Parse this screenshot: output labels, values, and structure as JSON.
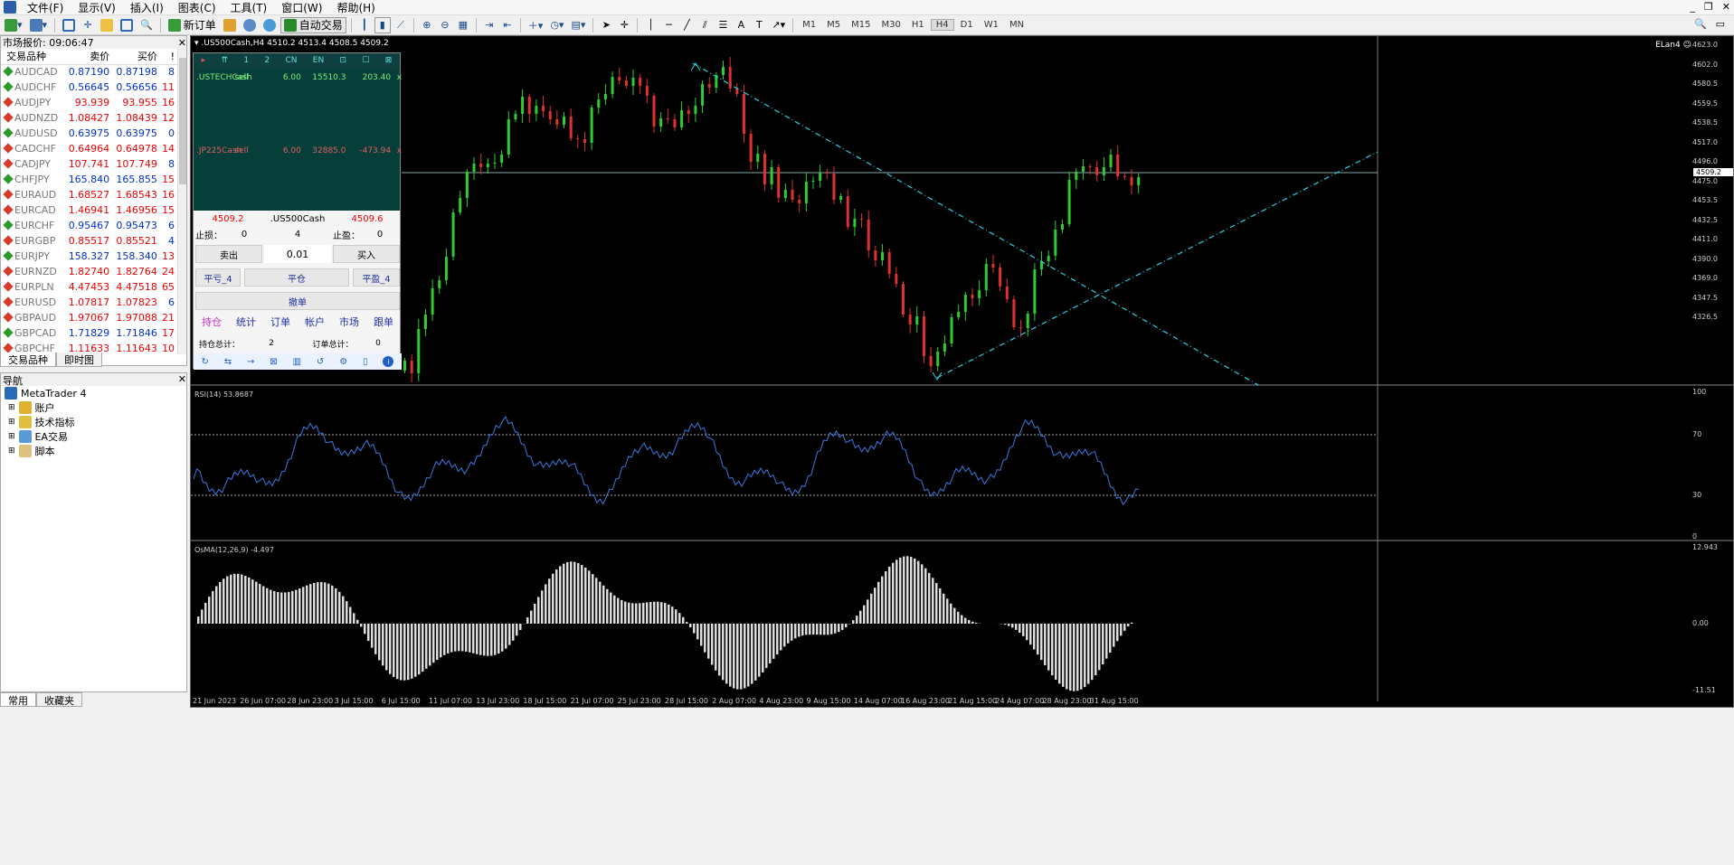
{
  "menu": [
    "文件(F)",
    "显示(V)",
    "插入(I)",
    "图表(C)",
    "工具(T)",
    "窗口(W)",
    "帮助(H)"
  ],
  "toolbar": {
    "new_order": "新订单",
    "auto_trade": "自动交易",
    "timeframes": [
      "M1",
      "M5",
      "M15",
      "M30",
      "H1",
      "H4",
      "D1",
      "W1",
      "MN"
    ],
    "active_tf": "H4"
  },
  "market_watch": {
    "title": "市场报价: 09:06:47",
    "cols": [
      "交易品种",
      "卖价",
      "买价",
      "!"
    ],
    "rows": [
      [
        "AUDCAD",
        "0.87190",
        "0.87198",
        "8",
        "up"
      ],
      [
        "AUDCHF",
        "0.56645",
        "0.56656",
        "11",
        "up"
      ],
      [
        "AUDJPY",
        "93.939",
        "93.955",
        "16",
        "dn"
      ],
      [
        "AUDNZD",
        "1.08427",
        "1.08439",
        "12",
        "dn"
      ],
      [
        "AUDUSD",
        "0.63975",
        "0.63975",
        "0",
        "up"
      ],
      [
        "CADCHF",
        "0.64964",
        "0.64978",
        "14",
        "dn"
      ],
      [
        "CADJPY",
        "107.741",
        "107.749",
        "8",
        "dn"
      ],
      [
        "CHFJPY",
        "165.840",
        "165.855",
        "15",
        "up"
      ],
      [
        "EURAUD",
        "1.68527",
        "1.68543",
        "16",
        "dn"
      ],
      [
        "EURCAD",
        "1.46941",
        "1.46956",
        "15",
        "dn"
      ],
      [
        "EURCHF",
        "0.95467",
        "0.95473",
        "6",
        "up"
      ],
      [
        "EURGBP",
        "0.85517",
        "0.85521",
        "4",
        "dn"
      ],
      [
        "EURJPY",
        "158.327",
        "158.340",
        "13",
        "up"
      ],
      [
        "EURNZD",
        "1.82740",
        "1.82764",
        "24",
        "dn"
      ],
      [
        "EURPLN",
        "4.47453",
        "4.47518",
        "65",
        "dn"
      ],
      [
        "EURUSD",
        "1.07817",
        "1.07823",
        "6",
        "dn"
      ],
      [
        "GBPAUD",
        "1.97067",
        "1.97088",
        "21",
        "dn"
      ],
      [
        "GBPCAD",
        "1.71829",
        "1.71846",
        "17",
        "up"
      ],
      [
        "GBPCHF",
        "1.11633",
        "1.11643",
        "10",
        "dn"
      ]
    ],
    "tabs": [
      "交易品种",
      "即时图"
    ]
  },
  "navigator": {
    "title": "导航",
    "root": "MetaTrader 4",
    "items": [
      "账户",
      "技术指标",
      "EA交易",
      "脚本"
    ],
    "tabs": [
      "常用",
      "收藏夹"
    ]
  },
  "chart": {
    "title": ".US500Cash,H4  4510.2 4513.4 4508.5 4509.2",
    "label": "ELan4",
    "price_axis": [
      "4623.0",
      "4602.0",
      "4580.5",
      "4559.5",
      "4538.5",
      "4517.0",
      "4496.0",
      "4475.0",
      "4453.5",
      "4432.5",
      "4411.0",
      "4390.0",
      "4369.0",
      "4347.5",
      "4326.5"
    ],
    "current_price": "4509.2",
    "rsi_title": "RSI(14) 53.8687",
    "rsi_axis": [
      "100",
      "70",
      "30",
      "0"
    ],
    "osma_title": "OsMA(12,26,9) -4.497",
    "osma_axis": [
      "12.943",
      "0.00",
      "-11.51"
    ],
    "time_axis": [
      "21 Jun 2023",
      "26 Jun 07:00",
      "28 Jun 23:00",
      "3 Jul 15:00",
      "6 Jul 15:00",
      "11 Jul 07:00",
      "13 Jul 23:00",
      "18 Jul 15:00",
      "21 Jul 07:00",
      "25 Jul 23:00",
      "28 Jul 15:00",
      "2 Aug 07:00",
      "4 Aug 23:00",
      "9 Aug 15:00",
      "14 Aug 07:00",
      "16 Aug 23:00",
      "21 Aug 15:00",
      "24 Aug 07:00",
      "28 Aug 23:00",
      "31 Aug 15:00"
    ]
  },
  "panel": {
    "tabs": [
      "1",
      "2",
      "CN",
      "EN"
    ],
    "pos1": {
      "sym": ".USTECHCash",
      "side": "sell",
      "lots": "6.00",
      "price": "15510.3",
      "pl": "203.40",
      "x": "x"
    },
    "pos2": {
      "sym": ".JP225Cash",
      "side": "sell",
      "lots": "6.00",
      "price": "32885.0",
      "pl": "-473.94",
      "x": "x"
    },
    "bid": "4509.2",
    "symbol": ".US500Cash",
    "ask": "4509.6",
    "sl_label": "止损：",
    "sl": "0",
    "spread": "4",
    "tp_label": "止盈：",
    "tp": "0",
    "sell": "卖出",
    "lot": "0.01",
    "buy": "买入",
    "close_n": "平亏_4",
    "close_all": "平仓",
    "close_p": "平盈_4",
    "cancel": "撤单",
    "menu": [
      "持仓",
      "统计",
      "订单",
      "帐户",
      "市场",
      "跟单"
    ],
    "total_pos_label": "持仓总计：",
    "total_pos": "2",
    "total_ord_label": "订单总计：",
    "total_ord": "0"
  }
}
